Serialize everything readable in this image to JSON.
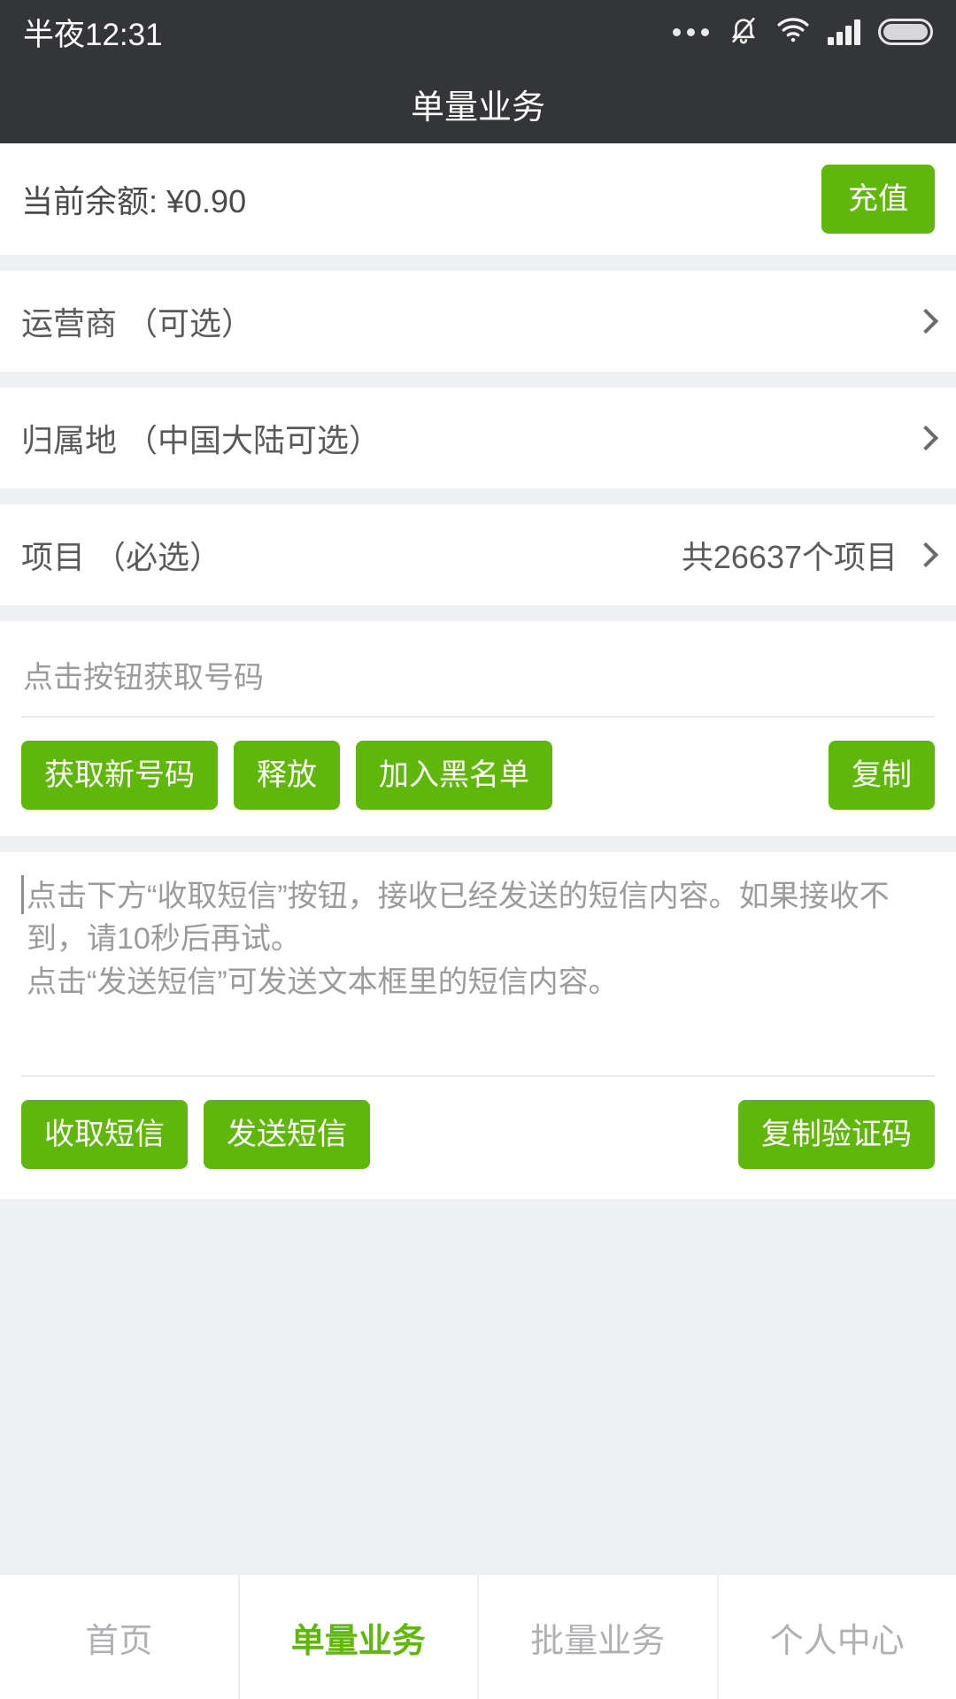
{
  "status_bar": {
    "time": "半夜12:31",
    "icons": [
      "more-dots-icon",
      "bell-muted-icon",
      "wifi-icon",
      "signal-icon",
      "battery-icon"
    ]
  },
  "header": {
    "title": "单量业务"
  },
  "balance": {
    "label": "当前余额: ¥0.90",
    "recharge_label": "充值"
  },
  "nav_rows": [
    {
      "label": "运营商 （可选）",
      "value": ""
    },
    {
      "label": "归属地 （中国大陆可选）",
      "value": ""
    },
    {
      "label": "项目 （必选）",
      "value": "共26637个项目"
    }
  ],
  "number_section": {
    "placeholder": "点击按钮获取号码",
    "buttons": {
      "get_new": "获取新号码",
      "release": "释放",
      "blacklist": "加入黑名单",
      "copy": "复制"
    }
  },
  "sms_section": {
    "placeholder": "点击下方“收取短信”按钮，接收已经发送的短信内容。如果接收不到，请10秒后再试。\n点击“发送短信”可发送文本框里的短信内容。",
    "value": "",
    "buttons": {
      "receive": "收取短信",
      "send": "发送短信",
      "copy_code": "复制验证码"
    }
  },
  "tabbar": {
    "items": [
      {
        "label": "首页",
        "active": false
      },
      {
        "label": "单量业务",
        "active": true
      },
      {
        "label": "批量业务",
        "active": false
      },
      {
        "label": "个人中心",
        "active": false
      }
    ]
  },
  "colors": {
    "accent_green": "#5fb709",
    "header_bg": "#343538",
    "page_bg": "#eeeff3",
    "text_primary": "#4a4a4a",
    "text_muted": "#9b9b9b"
  }
}
